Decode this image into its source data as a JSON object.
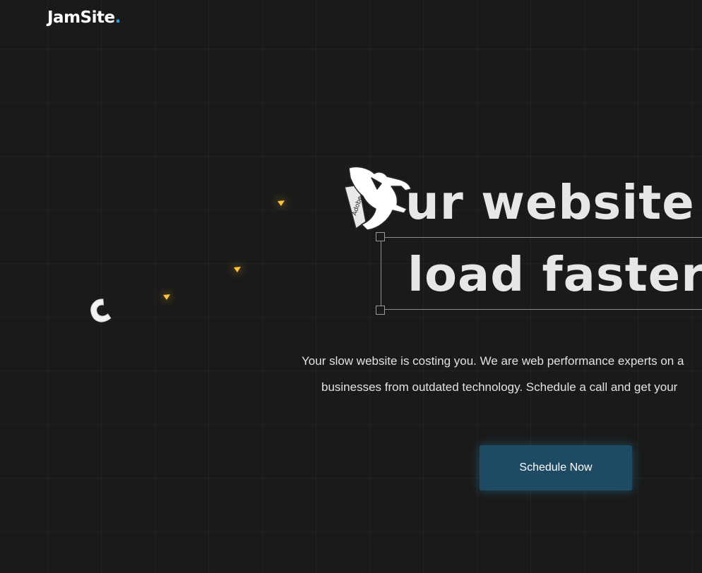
{
  "brand": {
    "name": "JamSite",
    "dot": "."
  },
  "hero": {
    "headline_line1": "ur website w",
    "headline_line2": "load faster.",
    "subtext_line1": "Your slow website is costing you. We are web performance experts on a",
    "subtext_line2": "businesses from outdated technology. Schedule a call and get your",
    "cta_label": "Schedule Now"
  },
  "icons": {
    "jump_figure": "jumping-figure-icon",
    "glyph_c": "c-letter-icon",
    "sparkle": "sparkle-icon"
  },
  "colors": {
    "background": "#1a1a1a",
    "accent": "#22a0e0",
    "cta_background": "#1f4a63",
    "headline": "#e7e7e7",
    "sparkle": "#ffc43c"
  }
}
